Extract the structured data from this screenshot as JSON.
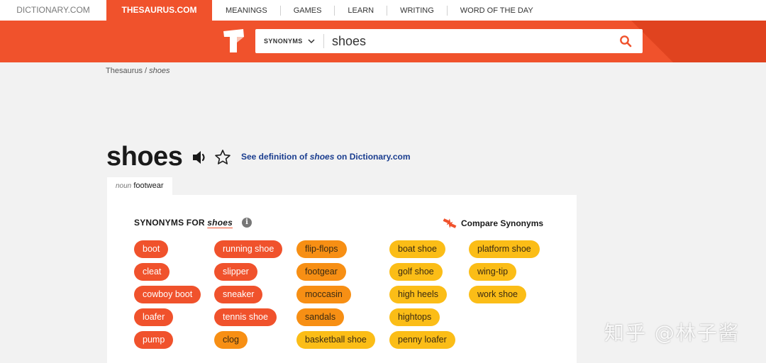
{
  "topnav": {
    "sites": [
      "DICTIONARY.COM",
      "THESAURUS.COM"
    ],
    "menu": [
      "MEANINGS",
      "GAMES",
      "LEARN",
      "WRITING",
      "WORD OF THE DAY"
    ]
  },
  "search": {
    "type_label": "SYNONYMS",
    "value": "shoes"
  },
  "breadcrumb": {
    "root": "Thesaurus",
    "sep": "/",
    "current": "shoes"
  },
  "entry": {
    "word": "shoes",
    "def_prefix": "See definition of",
    "def_word": "shoes",
    "def_suffix": "on Dictionary.com"
  },
  "sense_tab": {
    "pos": "noun",
    "sense": "footwear"
  },
  "synonyms": {
    "heading_prefix": "SYNONYMS FOR",
    "heading_word": "shoes",
    "info_glyph": "i",
    "compare_label": "Compare Synonyms",
    "columns": [
      [
        {
          "word": "boot",
          "relevance": "high"
        },
        {
          "word": "cleat",
          "relevance": "high"
        },
        {
          "word": "cowboy boot",
          "relevance": "high"
        },
        {
          "word": "loafer",
          "relevance": "high"
        },
        {
          "word": "pump",
          "relevance": "high"
        }
      ],
      [
        {
          "word": "running shoe",
          "relevance": "high"
        },
        {
          "word": "slipper",
          "relevance": "high"
        },
        {
          "word": "sneaker",
          "relevance": "high"
        },
        {
          "word": "tennis shoe",
          "relevance": "high"
        },
        {
          "word": "clog",
          "relevance": "medium"
        }
      ],
      [
        {
          "word": "flip-flops",
          "relevance": "medium"
        },
        {
          "word": "footgear",
          "relevance": "medium"
        },
        {
          "word": "moccasin",
          "relevance": "medium"
        },
        {
          "word": "sandals",
          "relevance": "medium"
        },
        {
          "word": "basketball shoe",
          "relevance": "low"
        }
      ],
      [
        {
          "word": "boat shoe",
          "relevance": "low"
        },
        {
          "word": "golf shoe",
          "relevance": "low"
        },
        {
          "word": "high heels",
          "relevance": "low"
        },
        {
          "word": "hightops",
          "relevance": "low"
        },
        {
          "word": "penny loafer",
          "relevance": "low"
        }
      ],
      [
        {
          "word": "platform shoe",
          "relevance": "low"
        },
        {
          "word": "wing-tip",
          "relevance": "low"
        },
        {
          "word": "work shoe",
          "relevance": "low"
        }
      ]
    ]
  },
  "colors": {
    "brand": "#f0522c",
    "high": "#f0522c",
    "medium": "#f78f14",
    "low": "#fbbd17",
    "link": "#1a3d8f"
  },
  "watermark": "知乎 @林子酱"
}
